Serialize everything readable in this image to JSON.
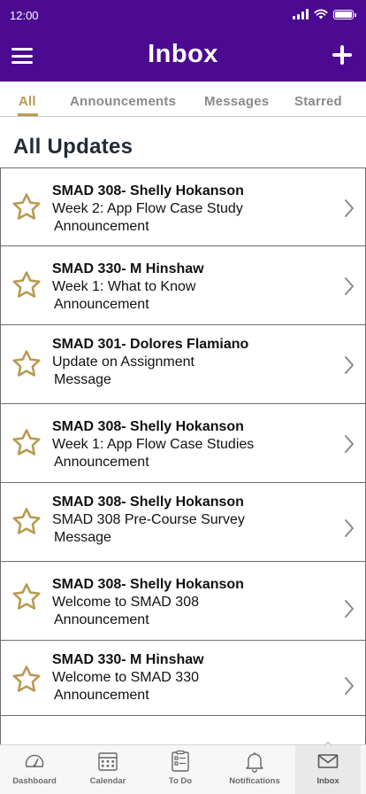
{
  "status_bar": {
    "time": "12:00"
  },
  "header": {
    "title": "Inbox"
  },
  "tabs": [
    {
      "label": "All",
      "active": true
    },
    {
      "label": "Announcements",
      "active": false
    },
    {
      "label": "Messages",
      "active": false
    },
    {
      "label": "Starred",
      "active": false
    }
  ],
  "section_title": "All Updates",
  "items": [
    {
      "sender": "SMAD 308- Shelly Hokanson",
      "subject": "Week 2: App Flow Case Study",
      "type": "Announcement"
    },
    {
      "sender": "SMAD 330- M Hinshaw",
      "subject": "Week 1: What to Know",
      "type": "Announcement"
    },
    {
      "sender": "SMAD 301- Dolores Flamiano",
      "subject": "Update on Assignment",
      "type": "Message"
    },
    {
      "sender": "SMAD 308- Shelly Hokanson",
      "subject": "Week 1: App Flow Case Studies",
      "type": "Announcement"
    },
    {
      "sender": "SMAD 308- Shelly Hokanson",
      "subject": "SMAD 308 Pre-Course Survey",
      "type": "Message"
    },
    {
      "sender": "SMAD 308- Shelly Hokanson",
      "subject": "Welcome to SMAD 308",
      "type": "Announcement"
    },
    {
      "sender": "SMAD 330- M Hinshaw",
      "subject": "Welcome to SMAD 330",
      "type": "Announcement"
    }
  ],
  "bottom_nav": [
    {
      "label": "Dashboard",
      "icon": "dashboard-icon"
    },
    {
      "label": "Calendar",
      "icon": "calendar-icon"
    },
    {
      "label": "To Do",
      "icon": "todo-icon"
    },
    {
      "label": "Notifications",
      "icon": "bell-icon"
    },
    {
      "label": "Inbox",
      "icon": "mail-icon",
      "active": true
    }
  ],
  "colors": {
    "header": "#4b0a91",
    "accent_gold": "#b99a52",
    "tab_inactive": "#8a8a8a",
    "card_border": "#6e6e6e"
  }
}
